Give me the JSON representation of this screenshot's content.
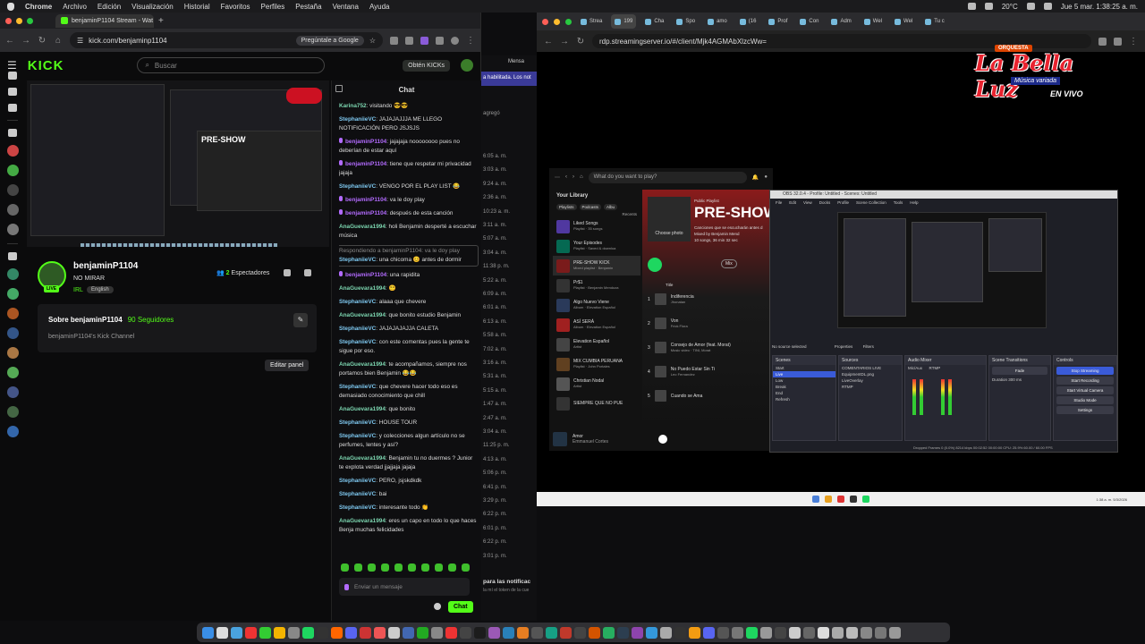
{
  "menubar": {
    "app": "Chrome",
    "items": [
      "Archivo",
      "Edición",
      "Visualización",
      "Historial",
      "Favoritos",
      "Perfiles",
      "Pestaña",
      "Ventana",
      "Ayuda"
    ],
    "temp": "20°C",
    "clock": "Jue 5 mar.  1:38:25 a. m."
  },
  "left_browser": {
    "tab_title": "benjaminP1104 Stream - Wat",
    "url": "kick.com/benjaminp1104",
    "ask_google": "Pregúntale a Google"
  },
  "kick": {
    "logo": "KICK",
    "search_placeholder": "Buscar",
    "get_kicks": "Obtén KICKs",
    "channel": {
      "name": "benjaminP1104",
      "title": "NO MIRAR",
      "category": "IRL",
      "language": "English",
      "viewers_count": "2",
      "viewers_label": "Espectadores",
      "live_badge": "LIVE"
    },
    "about": {
      "heading": "Sobre benjaminP1104",
      "followers": "90 Seguidores",
      "description": "benjaminP1104's Kick Channel"
    },
    "edit_panel": "Editar panel",
    "video_overlay": "PRE-SHOW"
  },
  "chat": {
    "title": "Chat",
    "input_placeholder": "Enviar un mensaje",
    "send_label": "Chat",
    "messages": [
      {
        "user": "Karina752",
        "color": "#7cd6b0",
        "text": "visitando 😎😎",
        "mic": false
      },
      {
        "user": "StephaniieVC",
        "color": "#7ec8f0",
        "text": "JAJAJAJJJA ME LLEGO NOTIFICACIÓN PERO JSJSJS",
        "mic": false
      },
      {
        "user": "benjaminP1104",
        "color": "#b36bff",
        "text": "jajajaja noooooooo pues no deberían de estar aquí",
        "mic": true
      },
      {
        "user": "benjaminP1104",
        "color": "#b36bff",
        "text": "tiene que respetar mi privacidad jajaja",
        "mic": true
      },
      {
        "user": "StephaniieVC",
        "color": "#7ec8f0",
        "text": "VENGO POR EL PLAY LIST 😂",
        "mic": false
      },
      {
        "user": "benjaminP1104",
        "color": "#b36bff",
        "text": "va le doy play",
        "mic": true
      },
      {
        "user": "benjaminP1104",
        "color": "#b36bff",
        "text": "después de esta canción",
        "mic": true
      },
      {
        "user": "AnaGuevara1994",
        "color": "#7cd6b0",
        "text": "holi Benjamin desperté a escuchar música",
        "mic": false
      },
      {
        "user": "StephaniieVC",
        "color": "#7ec8f0",
        "text": "una chicoma 😊 antes de dormir",
        "mic": false,
        "reply": "Respondiendo a benjaminP1104: va le doy play"
      },
      {
        "user": "benjaminP1104",
        "color": "#b36bff",
        "text": "una rapidita",
        "mic": true
      },
      {
        "user": "AnaGuevara1994",
        "color": "#7cd6b0",
        "text": "😵‍💫",
        "mic": false
      },
      {
        "user": "StephaniieVC",
        "color": "#7ec8f0",
        "text": "alaaa que chevere",
        "mic": false
      },
      {
        "user": "AnaGuevara1994",
        "color": "#7cd6b0",
        "text": "que bonito estudio Benjamin",
        "mic": false
      },
      {
        "user": "StephaniieVC",
        "color": "#7ec8f0",
        "text": "JAJAJAJAJJA CALETA",
        "mic": false
      },
      {
        "user": "StephaniieVC",
        "color": "#7ec8f0",
        "text": "con este comentas pues la gente te sigue por eso.",
        "mic": false
      },
      {
        "user": "AnaGuevara1994",
        "color": "#7cd6b0",
        "text": "te acompañamos, siempre nos portamos bien Benjamin 😂😂",
        "mic": false
      },
      {
        "user": "StephaniieVC",
        "color": "#7ec8f0",
        "text": "que chevere hacer todo eso es demasiado conocimiento que chill",
        "mic": false
      },
      {
        "user": "AnaGuevara1994",
        "color": "#7cd6b0",
        "text": "que bonito",
        "mic": false
      },
      {
        "user": "StephaniieVC",
        "color": "#7ec8f0",
        "text": "HOUSE TOUR",
        "mic": false
      },
      {
        "user": "StephaniieVC",
        "color": "#7ec8f0",
        "text": "y colecciones algun artículo no se perfumes, lentes y así?",
        "mic": false
      },
      {
        "user": "AnaGuevara1994",
        "color": "#7cd6b0",
        "text": "Benjamin tu no duermes ? Junior te explota verdad jjajjaja jajaja",
        "mic": false
      },
      {
        "user": "StephaniieVC",
        "color": "#7ec8f0",
        "text": "PERO, jsjskdkdk",
        "mic": false
      },
      {
        "user": "StephaniieVC",
        "color": "#7ec8f0",
        "text": "bai",
        "mic": false
      },
      {
        "user": "StephaniieVC",
        "color": "#7ec8f0",
        "text": "interesante todo 👏",
        "mic": false
      },
      {
        "user": "AnaGuevara1994",
        "color": "#7cd6b0",
        "text": "eres un capo en todo lo que haces Benja muchas felicidades",
        "mic": false
      }
    ]
  },
  "middle_window": {
    "header": "Mensa",
    "warning": "a habilitada. Los not",
    "label": "agregó",
    "times": [
      "6:05 a. m.",
      "3:03 a. m.",
      "9:24 a. m.",
      "2:36 a. m.",
      "10:23 a. m.",
      "3:11 a. m.",
      "5:07 a. m.",
      "3:04 a. m.",
      "11:38 p. m.",
      "5:22 a. m.",
      "6:09 a. m.",
      "6:01 a. m.",
      "6:13 a. m.",
      "5:58 a. m.",
      "7:02 a. m.",
      "3:16 a. m.",
      "5:31 a. m.",
      "5:15 a. m.",
      "1:47 a. m.",
      "2:47 a. m.",
      "3:04 a. m.",
      "11:25 p. m.",
      "4:13 a. m.",
      "5:06 p. m.",
      "6:41 p. m.",
      "3:29 p. m.",
      "6:22 p. m.",
      "6:01 p. m.",
      "6:22 p. m.",
      "3:01 p. m."
    ],
    "footer_title": "para las notificac",
    "footer_sub": "la mí el token de la cue"
  },
  "right_browser": {
    "tabs": [
      "Strea",
      "199",
      "Cha",
      "Spo",
      "amo",
      "(16",
      "Prof",
      "Con",
      "Adm",
      "Wel",
      "Wel",
      "Tu c"
    ],
    "url": "rdp.streamingserver.io/#/client/Mjk4AGMAbXlzcWw="
  },
  "overlay_logo": {
    "top": "ORQUESTA",
    "name": "La Bella Luz",
    "subtitle": "Música variada",
    "live": "EN VIVO"
  },
  "spotify": {
    "search_placeholder": "What do you want to play?",
    "library_title": "Your Library",
    "filters": [
      "Playlists",
      "Podcasts",
      "Albu"
    ],
    "recents": "Recents",
    "library": [
      {
        "name": "Liked Songs",
        "sub": "Playlist · 35 songs",
        "color": "#5038a0"
      },
      {
        "name": "Your Episodes",
        "sub": "Playlist · Saved & downloa",
        "color": "#056952"
      },
      {
        "name": "PRE-SHOW KICK",
        "sub": "Mixed playlist · Benjamin",
        "color": "#7a1b1b"
      },
      {
        "name": "Pr$1",
        "sub": "Playlist · Benjamin Mendoza",
        "color": "#333"
      },
      {
        "name": "Algo Nuevo Viene",
        "sub": "Album · Elevation Español",
        "color": "#2a3a5a"
      },
      {
        "name": "ASÍ SERÁ",
        "sub": "Album · Elevation Español",
        "color": "#a02020"
      },
      {
        "name": "Elevation Español",
        "sub": "Artist",
        "color": "#444"
      },
      {
        "name": "MIX CUMBIA PERUANA",
        "sub": "Playlist · John Portales",
        "color": "#604020"
      },
      {
        "name": "Christian Nodal",
        "sub": "Artist",
        "color": "#555"
      },
      {
        "name": "SIEMPRE QUE NO PUE",
        "sub": "",
        "color": "#333"
      }
    ],
    "playlist": {
      "type": "Public Playlist",
      "title": "PRE-SHOW",
      "choose_photo": "Choose photo",
      "desc": "Canciones que se escucharán antes d",
      "meta": "Mixed by Benjamin Mend",
      "stats": "10 songs, 36 min 32 sec",
      "mix_label": "Mix",
      "title_col": "Title",
      "tracks": [
        {
          "n": "1",
          "title": "Indiferencia",
          "artist": "Jhonatan"
        },
        {
          "n": "2",
          "title": "Von",
          "artist": "Frick Flora"
        },
        {
          "n": "3",
          "title": "Consejo de Amor (feat. Morat)",
          "artist": "Music video · TINI, Morat"
        },
        {
          "n": "4",
          "title": "No Puedo Estar Sin Ti",
          "artist": "Leo Fernandez"
        },
        {
          "n": "5",
          "title": "Cuando se Ama",
          "artist": ""
        }
      ]
    },
    "now_playing": {
      "title": "Amor",
      "artist": "Emmanuel Cortes"
    }
  },
  "obs": {
    "title": "OBS 32.0.4 - Profile: Untitled - Scenes: Untitled",
    "menu": [
      "File",
      "Edit",
      "View",
      "Docks",
      "Profile",
      "Scene Collection",
      "Tools",
      "Help"
    ],
    "no_source": "No source selected",
    "properties": "Properties",
    "filters": "Filters",
    "scenes_title": "Scenes",
    "scenes": [
      "Start",
      "Live",
      "Low",
      "Break",
      "End",
      "Refresh"
    ],
    "selected_scene": "Live",
    "sources_title": "Sources",
    "sources": [
      "COMENTARIOS LIVE",
      "EquipmentDL.png",
      "LiveOverlay",
      "RTMP"
    ],
    "mixer_title": "Audio Mixer",
    "mixer_channels": [
      "Mic/Aux",
      "RTMP"
    ],
    "transitions_title": "Scene Transitions",
    "transition": "Fade",
    "duration_label": "Duration",
    "duration": "300 ms",
    "controls_title": "Controls",
    "controls": [
      "Stop Streaming",
      "Start Recording",
      "Start Virtual Camera",
      "Studio Mode",
      "Settings"
    ],
    "status_bar": "Dropped Frames 0 (0.0%)   8214 kbps   00:02:52   00:00:00   CPU: 25.9%   60.00 / 60.00 FPS"
  },
  "windows_clock": "1:38 a. m. 5/3/2026"
}
